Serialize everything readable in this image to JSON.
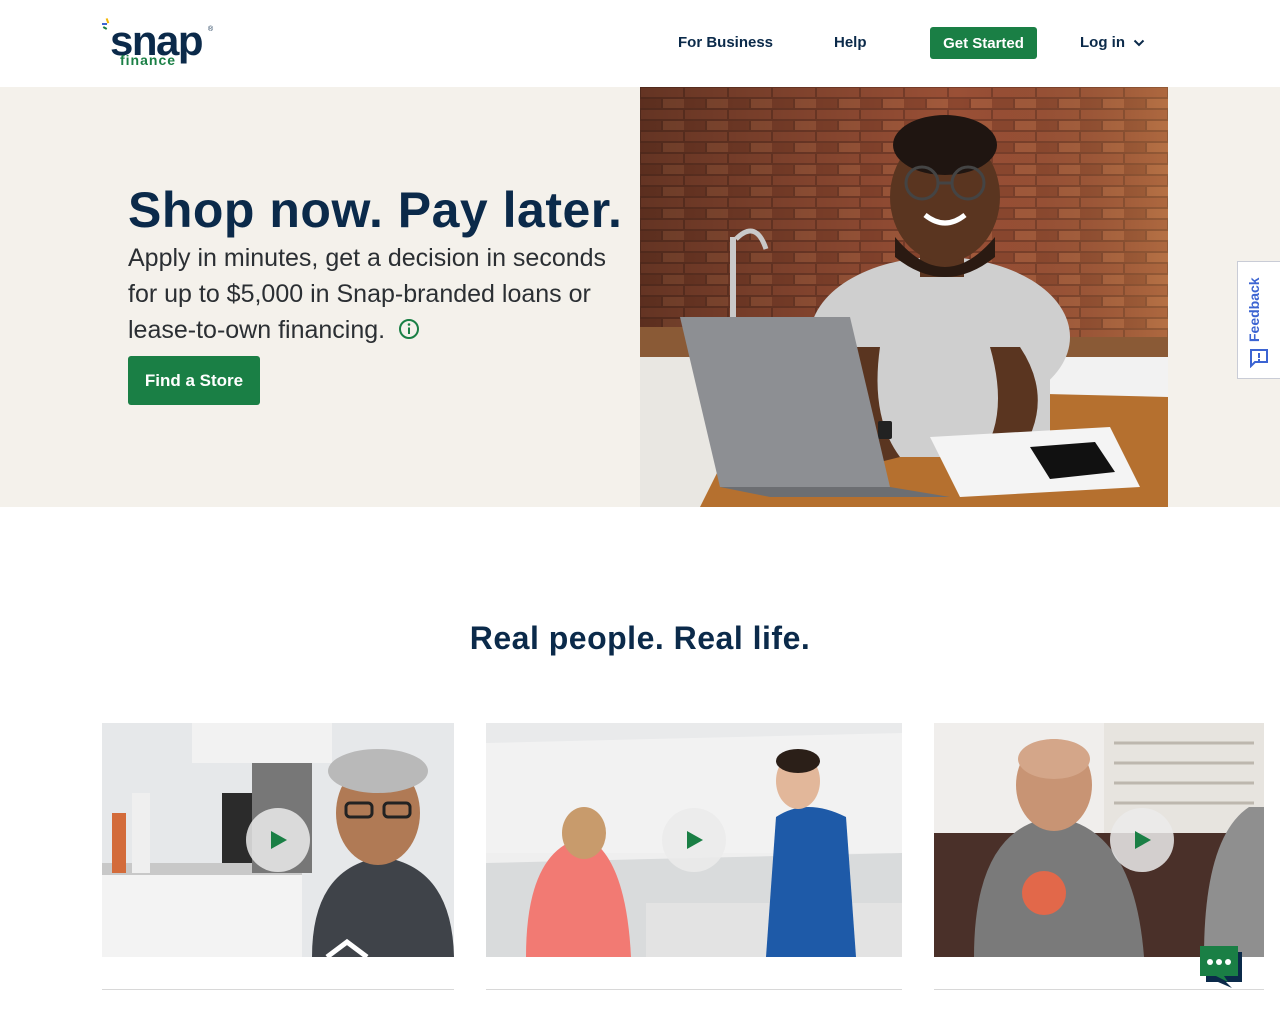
{
  "header": {
    "logo_text": "snap",
    "logo_subtext": "finance",
    "nav": {
      "business": "For Business",
      "help": "Help",
      "get_started": "Get Started",
      "login": "Log in"
    }
  },
  "hero": {
    "title": "Shop now. Pay later.",
    "subtitle": "Apply in minutes, get a decision in seconds for up to $5,000 in Snap-branded loans or lease-to-own financing.",
    "cta": "Find a Store"
  },
  "section": {
    "title": "Real people. Real life."
  },
  "feedback": {
    "label": "Feedback"
  },
  "colors": {
    "brand_green": "#1a7f45",
    "navy": "#0b2a4a",
    "hero_bg": "#f4f1eb"
  }
}
